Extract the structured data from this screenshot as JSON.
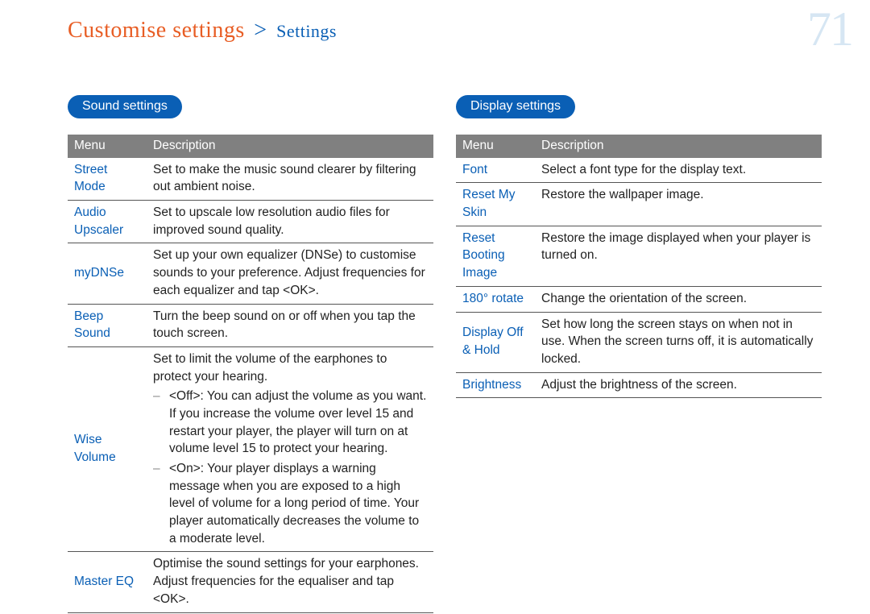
{
  "header": {
    "title_main": "Customise settings",
    "sep": ">",
    "title_sub": "Settings"
  },
  "page_number": "71",
  "col_left": {
    "heading": "Sound settings",
    "thead": {
      "c1": "Menu",
      "c2": "Description"
    },
    "rows": [
      {
        "menu": "Street Mode",
        "desc_plain": "Set to make the music sound clearer by filtering out ambient noise."
      },
      {
        "menu": "Audio Upscaler",
        "desc_plain": "Set to upscale low resolution audio files for improved sound quality."
      },
      {
        "menu": "myDNSe",
        "desc_plain": "Set up your own equalizer (DNSe) to customise sounds to your preference. Adjust frequencies for each equalizer and tap <OK>."
      },
      {
        "menu": "Beep Sound",
        "desc_plain": "Turn the beep sound on or off when you tap the touch screen."
      },
      {
        "menu": "Wise Volume",
        "desc_intro": "Set to limit the volume of the earphones to protect your hearing.",
        "bullets": [
          "<Off>: You can adjust the volume as you want. If you increase the volume over level 15 and restart your player, the player will turn on at volume level 15 to protect your hearing.",
          "<On>: Your player displays a warning message when you are exposed to a high level of volume for a long period of time. Your player automatically decreases the volume to a moderate level."
        ]
      },
      {
        "menu": "Master EQ",
        "desc_plain": "Optimise the sound settings for your earphones. Adjust frequencies for the equaliser and tap <OK>."
      }
    ]
  },
  "col_right": {
    "heading": "Display settings",
    "thead": {
      "c1": "Menu",
      "c2": "Description"
    },
    "rows": [
      {
        "menu": "Font",
        "desc_plain": "Select a font type for the display text."
      },
      {
        "menu": "Reset My Skin",
        "desc_plain": "Restore the wallpaper image."
      },
      {
        "menu": "Reset Booting Image",
        "desc_plain": "Restore the image displayed when your player is turned on."
      },
      {
        "menu": "180° rotate",
        "desc_plain": "Change the orientation of the screen."
      },
      {
        "menu": "Display Off & Hold",
        "desc_plain": "Set how long the screen stays on when not in use. When the screen turns off, it is automatically locked."
      },
      {
        "menu": "Brightness",
        "desc_plain": "Adjust the brightness of the screen."
      }
    ]
  }
}
